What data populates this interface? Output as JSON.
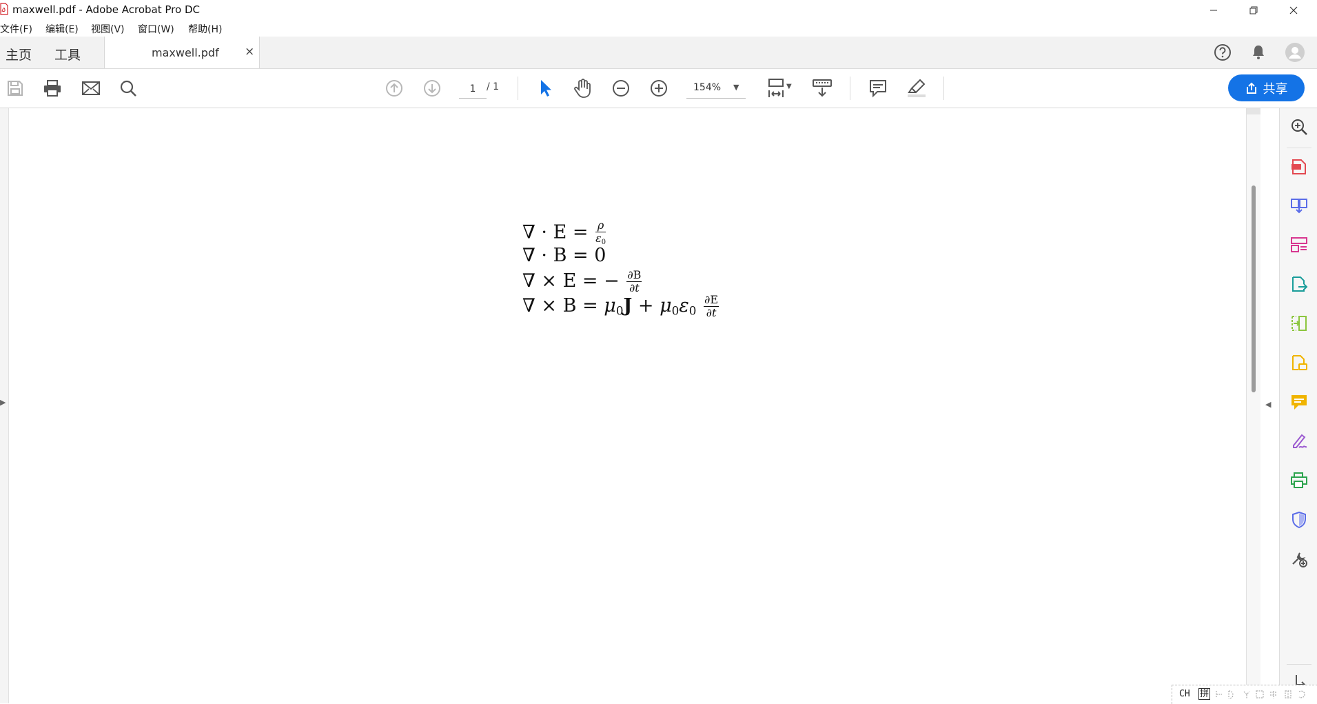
{
  "window": {
    "title": "maxwell.pdf - Adobe Acrobat Pro DC",
    "controls": [
      "minimize-icon",
      "restore-icon",
      "close-icon"
    ]
  },
  "menu": {
    "items": [
      "文件(F)",
      "编辑(E)",
      "视图(V)",
      "窗口(W)",
      "帮助(H)"
    ]
  },
  "tabs": {
    "home": "主页",
    "tools": "工具",
    "document": "maxwell.pdf",
    "close_glyph": "×"
  },
  "toolbar": {
    "page_current": "1",
    "page_total": "/ 1",
    "zoom": "154%",
    "share_label": "共享"
  },
  "accent": "#1473e6",
  "document": {
    "equations": {
      "eq1": {
        "lhs": "∇ · E =",
        "num": "ρ",
        "den": "ε",
        "den_sub": "0"
      },
      "eq2": {
        "text": "∇ · B = 0"
      },
      "eq3": {
        "lhs": "∇ × E = −",
        "num": "∂B",
        "den": "∂t"
      },
      "eq4": {
        "lhs": "∇ × B = ",
        "mu1": "μ",
        "mu1_sub": "0",
        "J": "J",
        "plus": " + ",
        "mu2": "μ",
        "mu2_sub": "0",
        "eps": "ε",
        "eps_sub": "0",
        "num": "∂E",
        "den": "∂t"
      }
    }
  },
  "right_panel_icons": [
    "zoom-search-icon",
    "create-pdf-icon",
    "combine-files-icon",
    "organize-pages-icon",
    "export-pdf-icon",
    "edit-pdf-icon",
    "request-signature-icon",
    "comment-icon",
    "fill-sign-icon",
    "print-production-icon",
    "protect-icon",
    "more-tools-icon"
  ],
  "ime": {
    "lang": "CH",
    "mode": "拼"
  }
}
